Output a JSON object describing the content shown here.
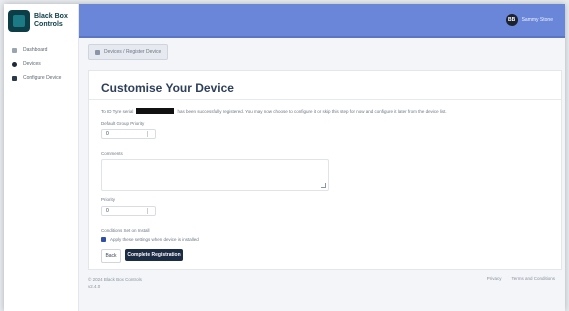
{
  "brand": {
    "name": "Black Box Controls"
  },
  "nav": [
    {
      "label": "Dashboard"
    },
    {
      "label": "Devices"
    },
    {
      "label": "Configure Device"
    }
  ],
  "user": {
    "initials": "BB",
    "name": "Sammy Stone"
  },
  "breadcrumb": {
    "text": "Devices / Register Device"
  },
  "card": {
    "title": "Customise Your Device",
    "intro_prefix": "To ID Tyre serial",
    "intro_suffix": "has been successfully registered. You may now choose to configure it or skip this step for now and configure it later from the device list."
  },
  "form": {
    "field1_label": "Default Group Priority",
    "field1_value": "0",
    "notes_label": "Comments",
    "field2_label": "Priority",
    "field2_value": "0",
    "checkbox_label": "Conditions Set on Install",
    "checkbox_text": "Apply these settings when device is installed"
  },
  "buttons": {
    "back": "Back",
    "complete": "Complete Registration"
  },
  "footer": {
    "left_line1": "© 2024 Black Box Controls",
    "left_line2": "v2.4.0",
    "right_link1": "Privacy",
    "right_link2": "Terms and Conditions"
  }
}
